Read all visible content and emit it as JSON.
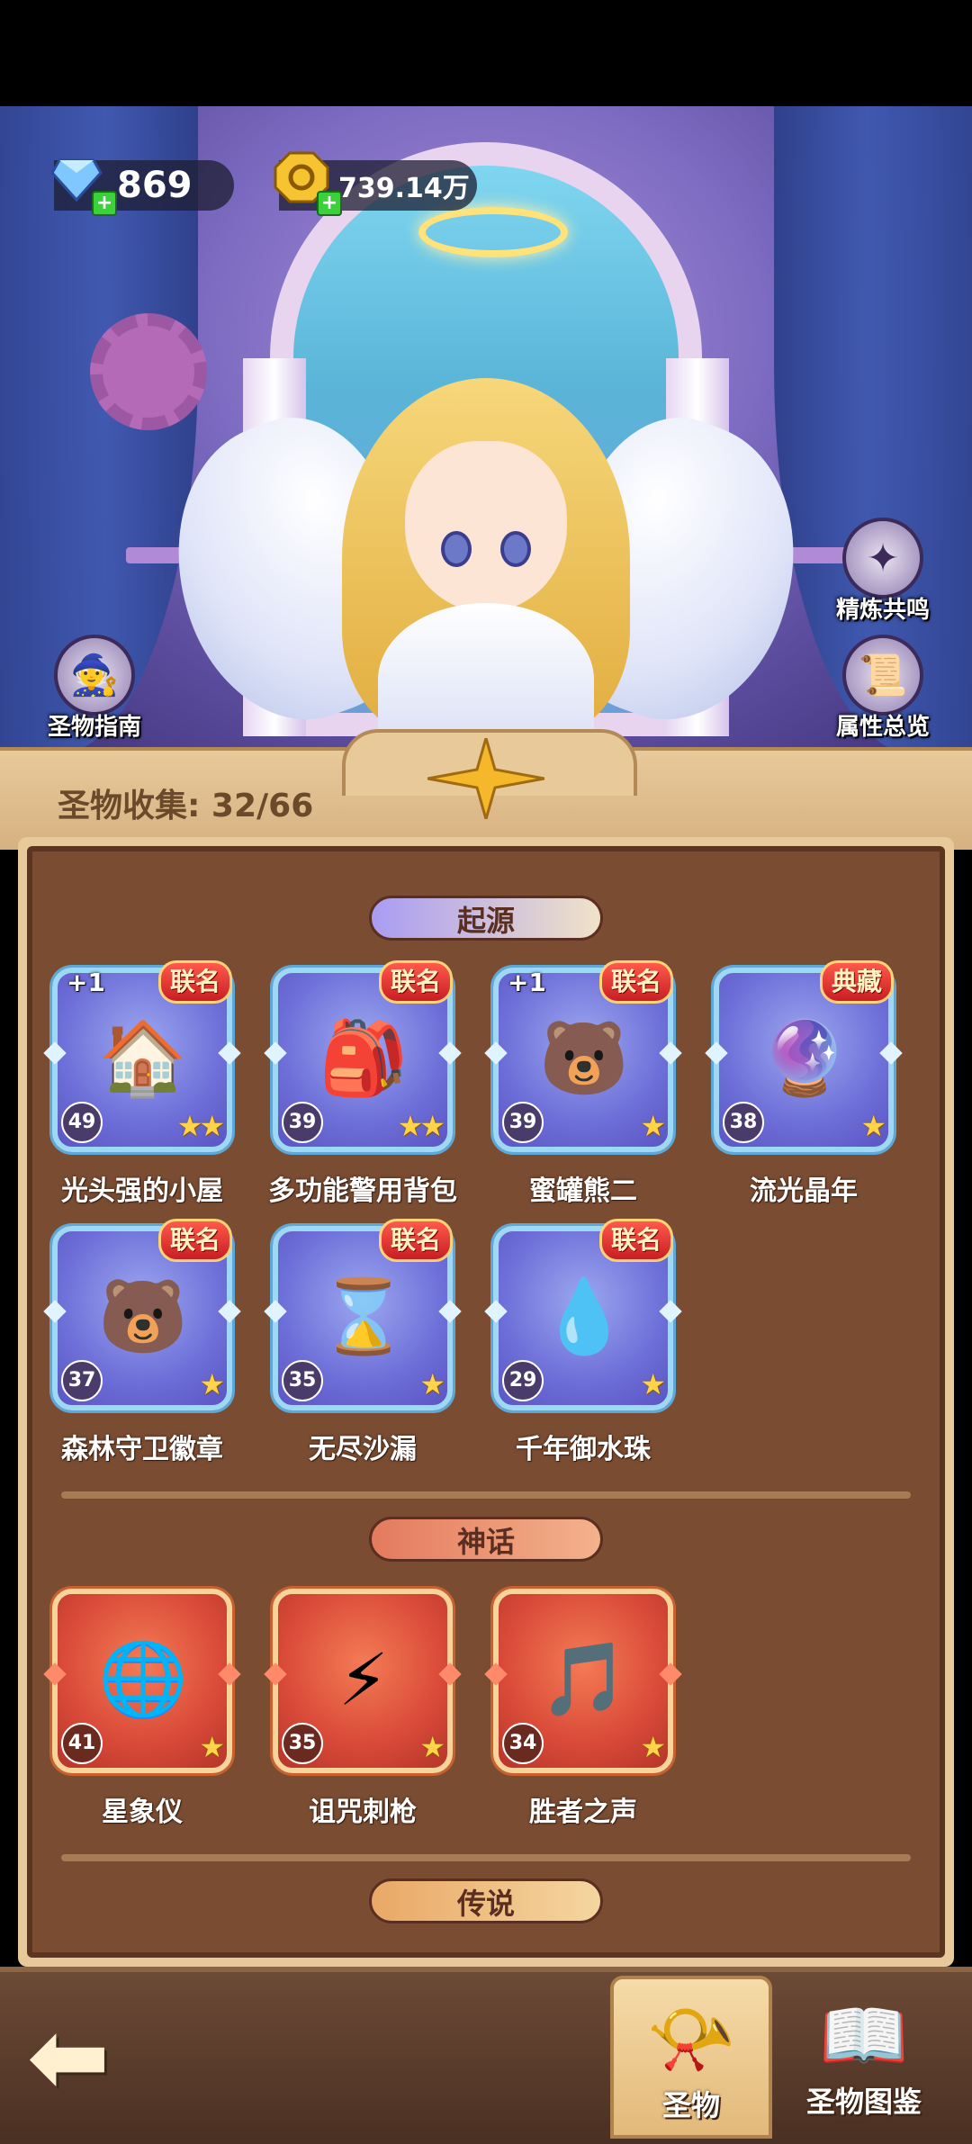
{
  "resources": {
    "diamonds": "869",
    "coins": "739.14万"
  },
  "side_buttons": {
    "guide": "圣物指南",
    "refine": "精炼共鸣",
    "stats": "属性总览"
  },
  "collection": {
    "label": "圣物收集: 32/66"
  },
  "categories": [
    {
      "name": "起源",
      "items": [
        {
          "name": "光头强的小屋",
          "level": "49",
          "badge": "联名",
          "plus": "+1",
          "stars": 2,
          "icon": "cabin-icon"
        },
        {
          "name": "多功能警用背包",
          "level": "39",
          "badge": "联名",
          "plus": "",
          "stars": 2,
          "icon": "backpack-icon"
        },
        {
          "name": "蜜罐熊二",
          "level": "39",
          "badge": "联名",
          "plus": "+1",
          "stars": 1,
          "icon": "bear-icon"
        },
        {
          "name": "流光晶年",
          "level": "38",
          "badge": "典藏",
          "plus": "",
          "stars": 1,
          "icon": "snowglobe-icon"
        },
        {
          "name": "森林守卫徽章",
          "level": "37",
          "badge": "联名",
          "plus": "",
          "stars": 1,
          "icon": "bear-badge-icon"
        },
        {
          "name": "无尽沙漏",
          "level": "35",
          "badge": "联名",
          "plus": "",
          "stars": 1,
          "icon": "hourglass-icon"
        },
        {
          "name": "千年御水珠",
          "level": "29",
          "badge": "联名",
          "plus": "",
          "stars": 1,
          "icon": "water-orb-icon"
        }
      ]
    },
    {
      "name": "神话",
      "items": [
        {
          "name": "星象仪",
          "level": "41",
          "stars": 1,
          "icon": "astrolabe-icon"
        },
        {
          "name": "诅咒刺枪",
          "level": "35",
          "stars": 1,
          "icon": "spear-icon"
        },
        {
          "name": "胜者之声",
          "level": "34",
          "stars": 1,
          "icon": "flute-icon"
        }
      ]
    },
    {
      "name": "传说",
      "items": []
    }
  ],
  "bottom_tabs": {
    "relics": "圣物",
    "codex": "圣物图鉴"
  },
  "colors": {
    "origin_card": "#6e6fd8",
    "myth_card": "#d94a38",
    "panel_bg": "#7a4d33",
    "badge": "#c81e24"
  }
}
